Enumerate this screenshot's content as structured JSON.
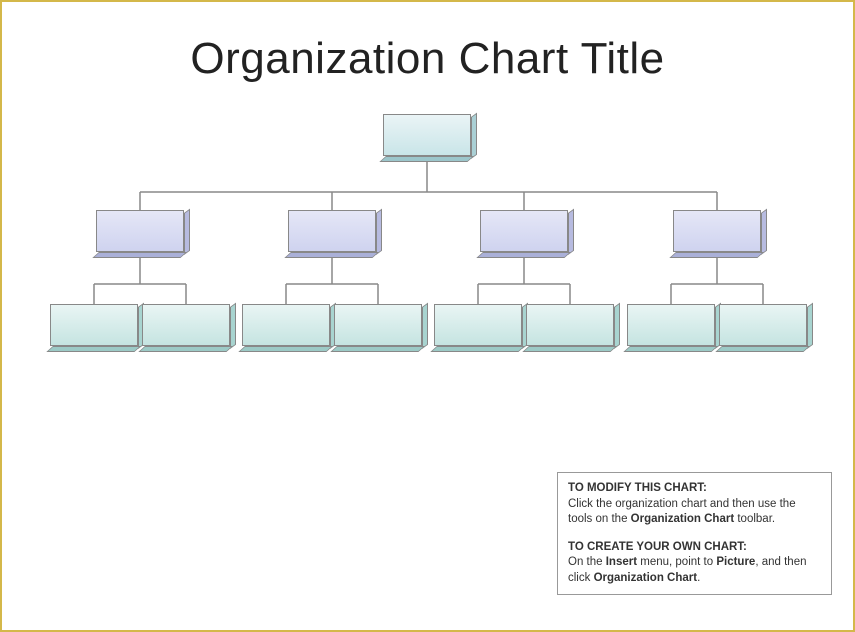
{
  "title": "Organization Chart Title",
  "instructions": {
    "modify_heading": "TO MODIFY THIS CHART:",
    "modify_text_pre": "Click the organization chart and then use the tools on the ",
    "modify_bold1": "Organization Chart",
    "modify_text_post": " toolbar.",
    "create_heading": "TO CREATE YOUR OWN CHART:",
    "create_text_pre": "On the ",
    "create_bold1": "Insert",
    "create_text_mid1": " menu, point to ",
    "create_bold2": "Picture",
    "create_text_mid2": ", and then click ",
    "create_bold3": "Organization Chart",
    "create_text_post": "."
  }
}
